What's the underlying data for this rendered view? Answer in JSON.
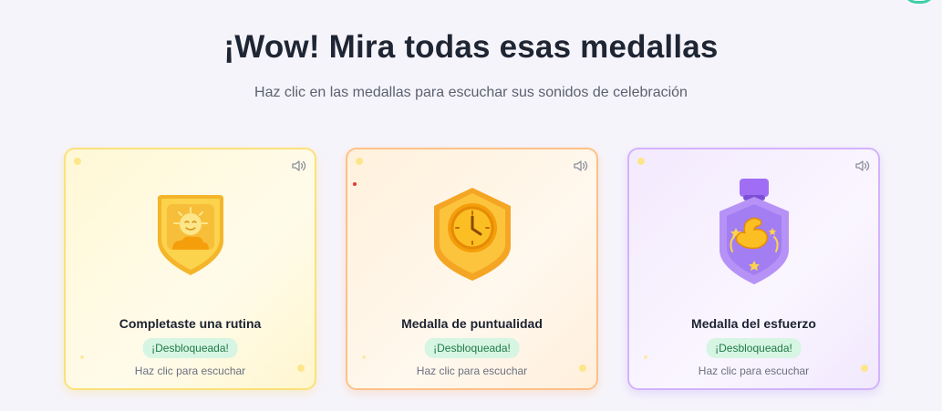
{
  "header": {
    "title": "¡Wow! Mira todas esas medallas",
    "subtitle": "Haz clic en las medallas para escuchar sus sonidos de celebración"
  },
  "medals": [
    {
      "title": "Completaste una rutina",
      "status": "¡Desbloqueada!",
      "hint": "Haz clic para escuchar",
      "icon": "sun-shield-icon",
      "accent": "#fbe17a"
    },
    {
      "title": "Medalla de puntualidad",
      "status": "¡Desbloqueada!",
      "hint": "Haz clic para escuchar",
      "icon": "clock-shield-icon",
      "accent": "#fdc189"
    },
    {
      "title": "Medalla del esfuerzo",
      "status": "¡Desbloqueada!",
      "hint": "Haz clic para escuchar",
      "icon": "muscle-medal-icon",
      "accent": "#d3b3fb"
    }
  ]
}
